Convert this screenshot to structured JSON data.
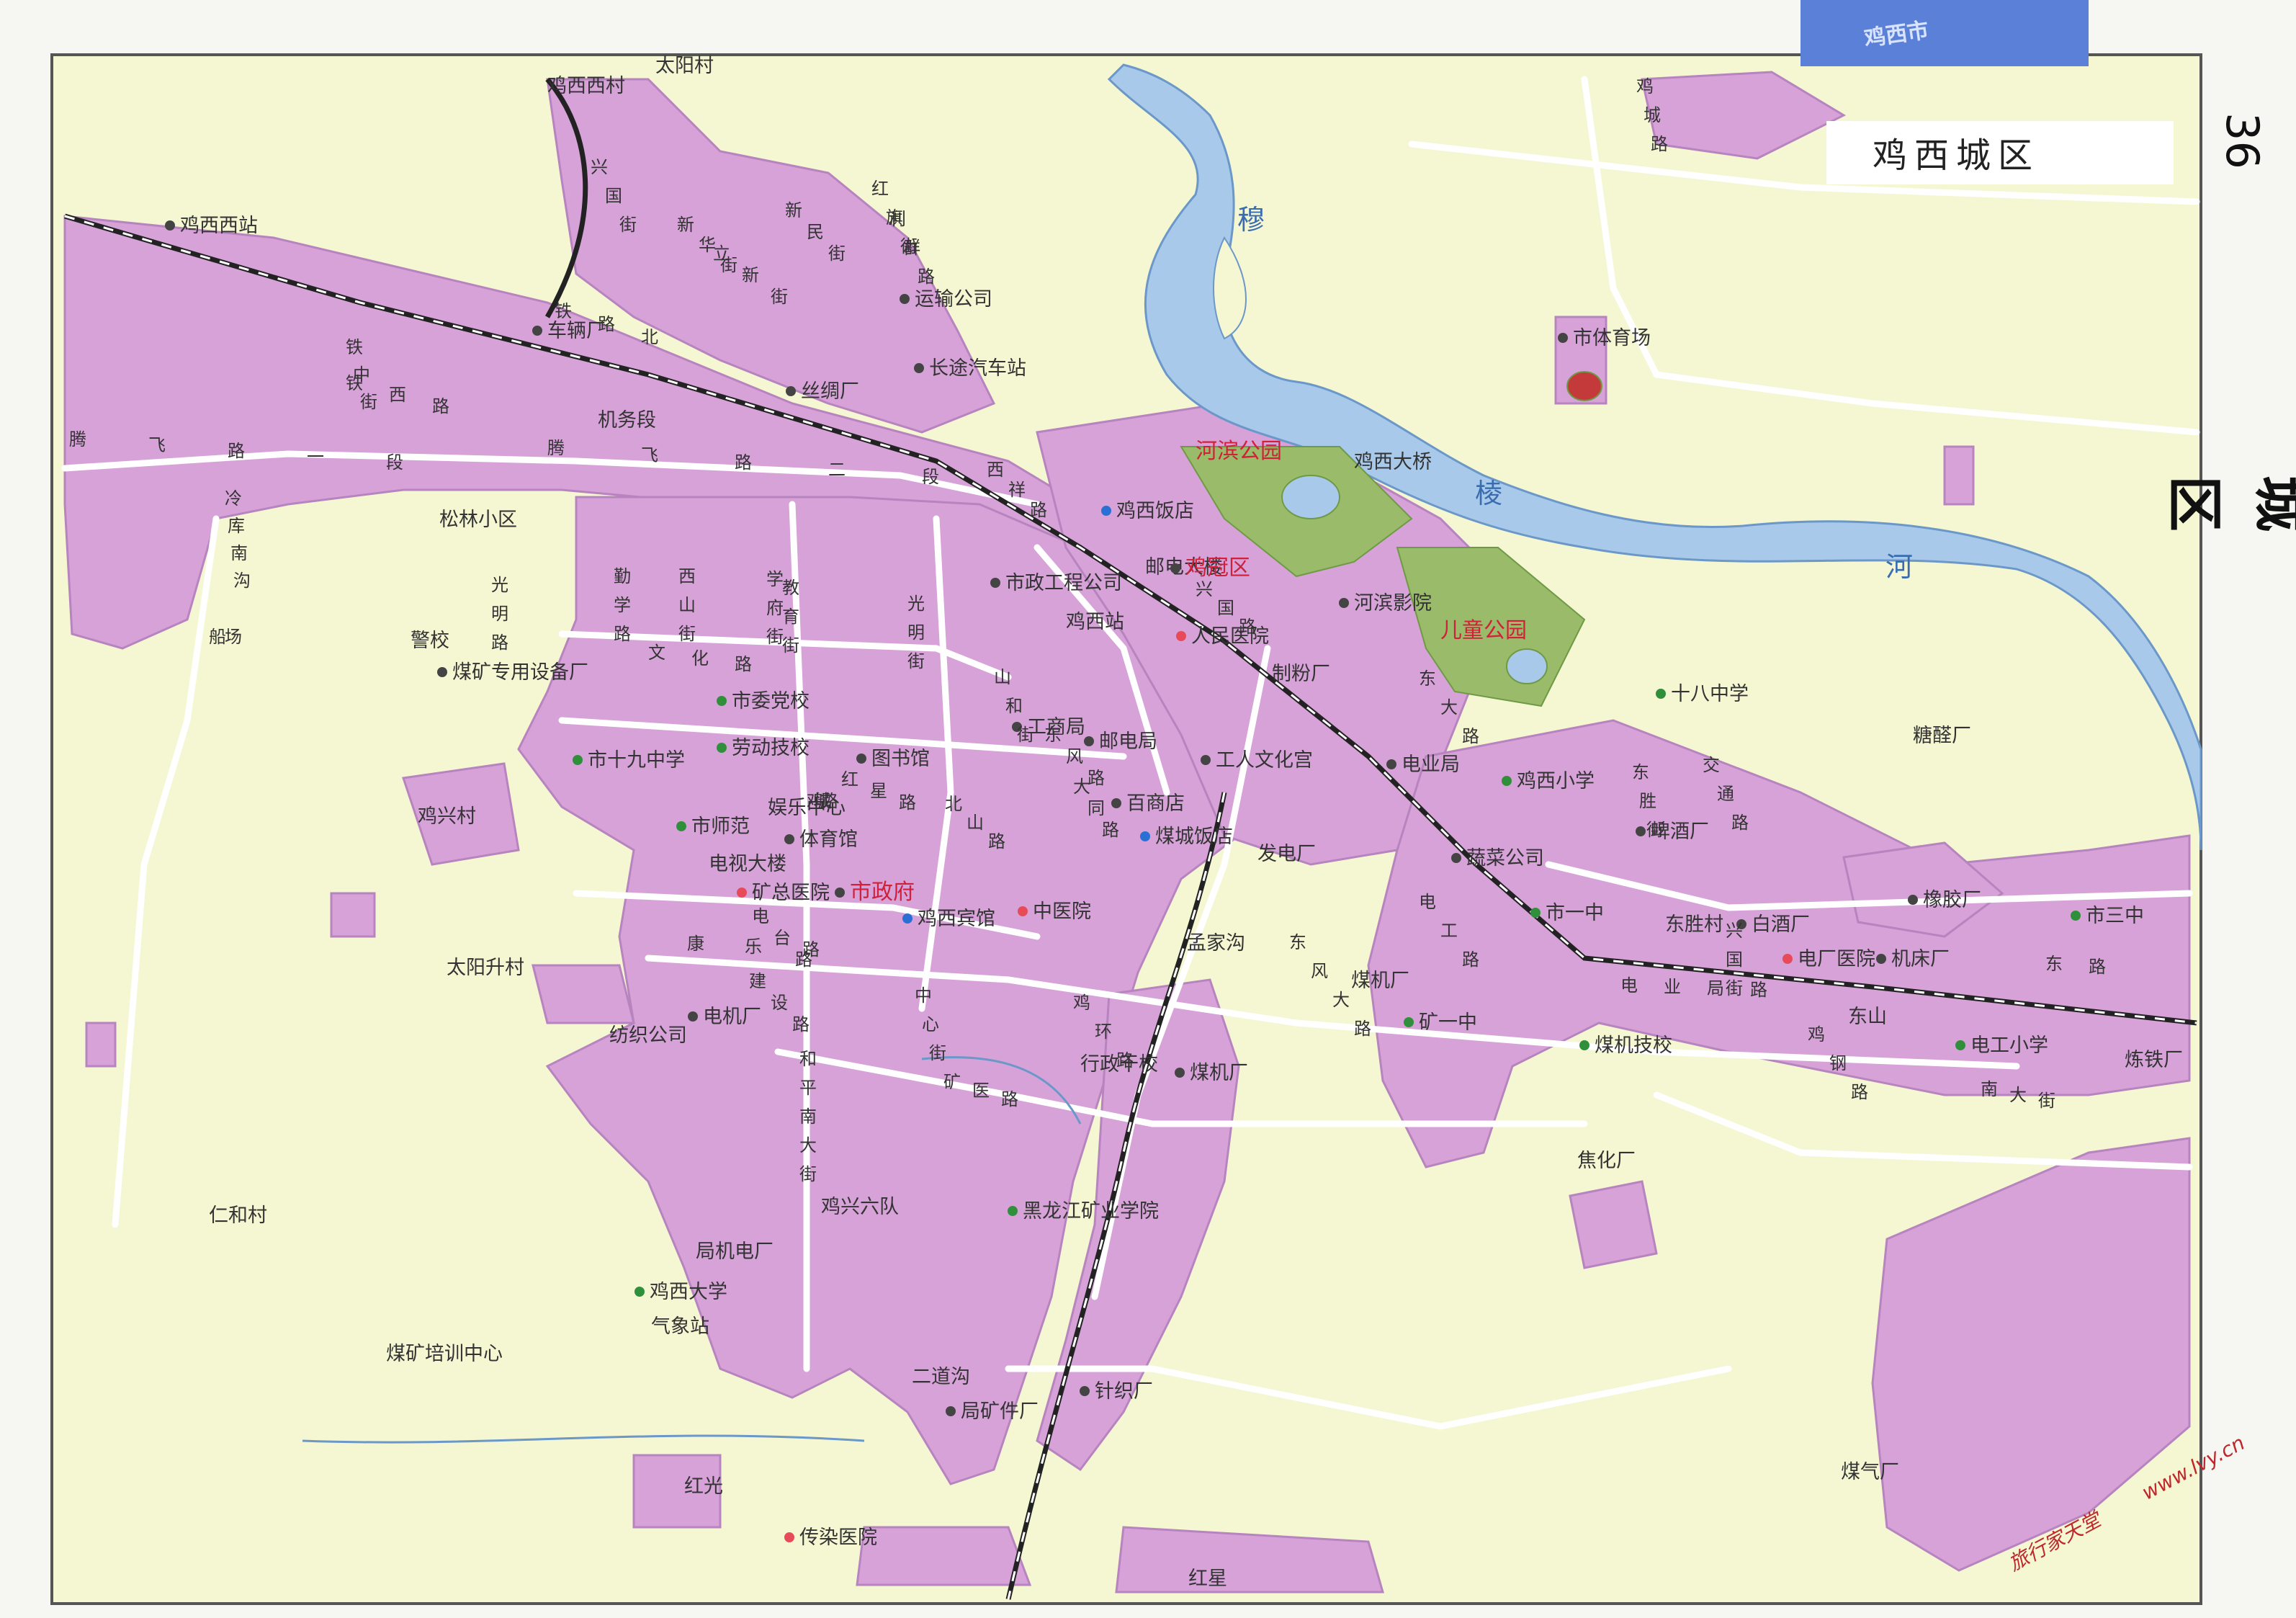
{
  "page_number": "36",
  "side_title": "鸡西城区",
  "map_title": "鸡西城区",
  "corner_tab": "鸡西市",
  "watermark": {
    "site": "旅行家天堂",
    "url": "www.lvy.cn"
  },
  "colors": {
    "land": "#f4f7d2",
    "urban": "#d6a2d8",
    "urban_stroke": "#b784bf",
    "water": "#a9c9ea",
    "water_stroke": "#6b98c8",
    "park": "#99bb6a",
    "railway": "#222222",
    "road": "#ffffff",
    "label": "#333333",
    "label_red": "#d0203a",
    "river_label": "#3a6db0",
    "border": "#555555",
    "tab": "#5b80d8",
    "watermark": "#c0272d"
  },
  "rivers": {
    "main": {
      "chars": [
        "穆",
        "棱",
        "河"
      ]
    }
  },
  "places": [
    {
      "text": "鸡西西站",
      "icon": "station-icon"
    },
    {
      "text": "鸡西西村"
    },
    {
      "text": "车辆厂",
      "icon": "factory-icon"
    },
    {
      "text": "丝绸厂",
      "icon": "factory-icon"
    },
    {
      "text": "运输公司",
      "icon": "company-icon"
    },
    {
      "text": "长途汽车站",
      "icon": "bus-station-icon"
    },
    {
      "text": "机务段"
    },
    {
      "text": "松林小区"
    },
    {
      "text": "市体育场",
      "icon": "stadium-icon"
    },
    {
      "text": "河滨公园",
      "red": true
    },
    {
      "text": "鸡西大桥"
    },
    {
      "text": "鸡西饭店",
      "icon": "hotel-icon"
    },
    {
      "text": "邮电大楼"
    },
    {
      "text": "鸡冠区",
      "red": true,
      "icon": "district-seat-icon"
    },
    {
      "text": "市政工程公司",
      "icon": "company-icon"
    },
    {
      "text": "河滨影院",
      "icon": "cinema-icon"
    },
    {
      "text": "儿童公园",
      "red": true
    },
    {
      "text": "鸡西站"
    },
    {
      "text": "人民医院",
      "icon": "hospital-icon"
    },
    {
      "text": "制粉厂"
    },
    {
      "text": "十八中学",
      "icon": "school-icon"
    },
    {
      "text": "糖醛厂"
    },
    {
      "text": "警校"
    },
    {
      "text": "煤矿专用设备厂",
      "icon": "factory-icon"
    },
    {
      "text": "市委党校",
      "icon": "school-icon"
    },
    {
      "text": "劳动技校",
      "icon": "school-icon"
    },
    {
      "text": "市十九中学",
      "icon": "school-icon"
    },
    {
      "text": "工商局",
      "icon": "company-icon"
    },
    {
      "text": "邮电局",
      "icon": "post-icon"
    },
    {
      "text": "电业局",
      "icon": "post-icon"
    },
    {
      "text": "鸡西小学",
      "icon": "school-icon"
    },
    {
      "text": "图书馆",
      "icon": "library-icon"
    },
    {
      "text": "工人文化宫",
      "icon": "culture-icon"
    },
    {
      "text": "鸡兴村"
    },
    {
      "text": "娱乐中心"
    },
    {
      "text": "市师范",
      "icon": "school-icon"
    },
    {
      "text": "百商店",
      "icon": "company-icon"
    },
    {
      "text": "体育馆",
      "icon": "gym-icon"
    },
    {
      "text": "煤城饭店",
      "icon": "hotel-icon"
    },
    {
      "text": "发电厂"
    },
    {
      "text": "啤酒厂",
      "icon": "factory-icon"
    },
    {
      "text": "电视大楼"
    },
    {
      "text": "蔬菜公司",
      "icon": "company-icon"
    },
    {
      "text": "矿总医院",
      "icon": "hospital-icon"
    },
    {
      "text": "市政府",
      "red": true,
      "icon": "government-icon"
    },
    {
      "text": "鸡西宾馆",
      "icon": "hotel-icon"
    },
    {
      "text": "中医院",
      "icon": "hospital-icon"
    },
    {
      "text": "市一中",
      "icon": "school-icon"
    },
    {
      "text": "东胜村"
    },
    {
      "text": "白酒厂",
      "icon": "factory-icon"
    },
    {
      "text": "橡胶厂",
      "icon": "factory-icon"
    },
    {
      "text": "市三中",
      "icon": "school-icon"
    },
    {
      "text": "太阳升村"
    },
    {
      "text": "孟家沟"
    },
    {
      "text": "煤机厂"
    },
    {
      "text": "电厂医院",
      "icon": "hospital-icon"
    },
    {
      "text": "机床厂",
      "icon": "factory-icon"
    },
    {
      "text": "电机厂",
      "icon": "factory-icon"
    },
    {
      "text": "矿一中",
      "icon": "school-icon"
    },
    {
      "text": "东山"
    },
    {
      "text": "纺织公司"
    },
    {
      "text": "行政干校"
    },
    {
      "text": "煤机厂",
      "icon": "factory-icon"
    },
    {
      "text": "煤机技校",
      "icon": "school-icon"
    },
    {
      "text": "电工小学",
      "icon": "school-icon"
    },
    {
      "text": "炼铁厂"
    },
    {
      "text": "焦化厂"
    },
    {
      "text": "仁和村"
    },
    {
      "text": "鸡兴六队"
    },
    {
      "text": "黑龙江矿业学院",
      "icon": "school-icon"
    },
    {
      "text": "局机电厂"
    },
    {
      "text": "鸡西大学",
      "icon": "school-icon"
    },
    {
      "text": "气象站"
    },
    {
      "text": "煤矿培训中心"
    },
    {
      "text": "二道沟"
    },
    {
      "text": "针织厂",
      "icon": "company-icon"
    },
    {
      "text": "局矿件厂",
      "icon": "company-icon"
    },
    {
      "text": "煤气厂"
    },
    {
      "text": "红光"
    },
    {
      "text": "传染医院",
      "icon": "hospital-icon"
    },
    {
      "text": "红星"
    },
    {
      "text": "太阳村"
    }
  ],
  "streets": [
    {
      "chars": [
        "兴",
        "国",
        "街"
      ]
    },
    {
      "chars": [
        "新",
        "华",
        "街"
      ]
    },
    {
      "chars": [
        "新",
        "民",
        "街"
      ]
    },
    {
      "chars": [
        "立",
        "新",
        "街"
      ]
    },
    {
      "chars": [
        "红",
        "旗",
        "街"
      ]
    },
    {
      "chars": [
        "西",
        "祥",
        "路"
      ]
    },
    {
      "chars": [
        "利",
        "群",
        "路"
      ]
    },
    {
      "chars": [
        "铁",
        "路",
        "北"
      ]
    },
    {
      "chars": [
        "铁",
        "西",
        "路"
      ]
    },
    {
      "chars": [
        "铁",
        "中",
        "街"
      ]
    },
    {
      "chars": [
        "腾",
        "飞",
        "路",
        "一",
        "段"
      ]
    },
    {
      "chars": [
        "腾",
        "飞",
        "路",
        "二",
        "段"
      ]
    },
    {
      "chars": [
        "冷",
        "库",
        "南",
        "沟"
      ]
    },
    {
      "chars": [
        "船",
        "场"
      ]
    },
    {
      "chars": [
        "光",
        "明",
        "路"
      ]
    },
    {
      "chars": [
        "勤",
        "学",
        "路"
      ]
    },
    {
      "chars": [
        "西",
        "山",
        "街"
      ]
    },
    {
      "chars": [
        "文",
        "化",
        "路"
      ]
    },
    {
      "chars": [
        "学",
        "府",
        "街"
      ]
    },
    {
      "chars": [
        "教",
        "育",
        "街"
      ]
    },
    {
      "chars": [
        "光",
        "明",
        "街"
      ]
    },
    {
      "chars": [
        "红",
        "星",
        "路"
      ]
    },
    {
      "chars": [
        "山",
        "和",
        "街"
      ]
    },
    {
      "chars": [
        "东",
        "风",
        "路"
      ]
    },
    {
      "chars": [
        "北",
        "山",
        "路"
      ]
    },
    {
      "chars": [
        "大",
        "同",
        "路"
      ]
    },
    {
      "chars": [
        "兴",
        "国",
        "路"
      ]
    },
    {
      "chars": [
        "鸡",
        "城",
        "路"
      ]
    },
    {
      "chars": [
        "电",
        "台",
        "路"
      ]
    },
    {
      "chars": [
        "康",
        "乐",
        "路"
      ]
    },
    {
      "chars": [
        "建",
        "设",
        "路"
      ]
    },
    {
      "chars": [
        "和",
        "平",
        "南",
        "大",
        "街"
      ]
    },
    {
      "chars": [
        "矿",
        "医",
        "路"
      ]
    },
    {
      "chars": [
        "中",
        "心",
        "街"
      ]
    },
    {
      "chars": [
        "鸡",
        "环",
        "路"
      ]
    },
    {
      "chars": [
        "东",
        "风",
        "大",
        "路"
      ]
    },
    {
      "chars": [
        "东",
        "胜",
        "街"
      ]
    },
    {
      "chars": [
        "电",
        "工",
        "路"
      ]
    },
    {
      "chars": [
        "电",
        "业",
        "局",
        "路"
      ]
    },
    {
      "chars": [
        "兴",
        "国",
        "街"
      ]
    },
    {
      "chars": [
        "鸡",
        "钢",
        "路"
      ]
    },
    {
      "chars": [
        "东",
        "路"
      ]
    },
    {
      "chars": [
        "南",
        "大",
        "街"
      ]
    },
    {
      "chars": [
        "交",
        "通",
        "路"
      ]
    },
    {
      "chars": [
        "东",
        "大",
        "路"
      ]
    },
    {
      "chars": [
        "鸡",
        "城",
        "路"
      ]
    }
  ]
}
